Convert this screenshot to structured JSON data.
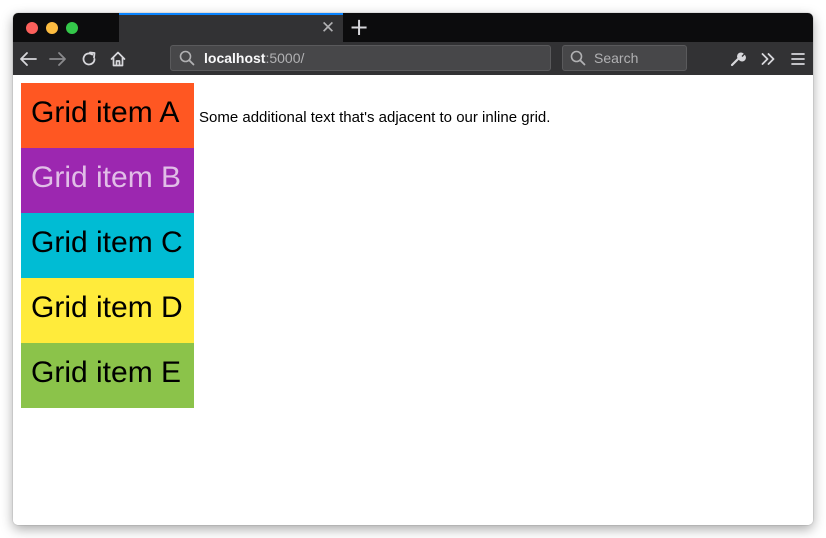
{
  "browser": {
    "tab": {
      "title": "",
      "close_icon": "✕"
    },
    "new_tab_icon": "+",
    "toolbar": {
      "back_icon": "arrow-left-icon",
      "forward_icon": "arrow-right-icon",
      "reload_icon": "reload-icon",
      "home_icon": "home-icon",
      "url": {
        "host": "localhost",
        "rest": ":5000/"
      },
      "search_placeholder": "Search",
      "tools_icon": "wrench-icon",
      "overflow_icon": "»",
      "menu_icon": "hamburger-icon"
    },
    "traffic_lights": {
      "close": "#fc605b",
      "minimize": "#fdbc40",
      "maximize": "#34c84a"
    },
    "accent": "#0a84ff"
  },
  "page": {
    "grid_items": [
      {
        "label": "Grid item A",
        "bg": "#ff5722",
        "color": "#000000"
      },
      {
        "label": "Grid item B",
        "bg": "#9c27b0",
        "color": "#e1bee7"
      },
      {
        "label": "Grid item C",
        "bg": "#00bcd4",
        "color": "#000000"
      },
      {
        "label": "Grid item D",
        "bg": "#ffeb3b",
        "color": "#000000"
      },
      {
        "label": "Grid item E",
        "bg": "#8bc34a",
        "color": "#000000"
      }
    ],
    "adjacent_text": "Some additional text that's adjacent to our inline grid."
  }
}
